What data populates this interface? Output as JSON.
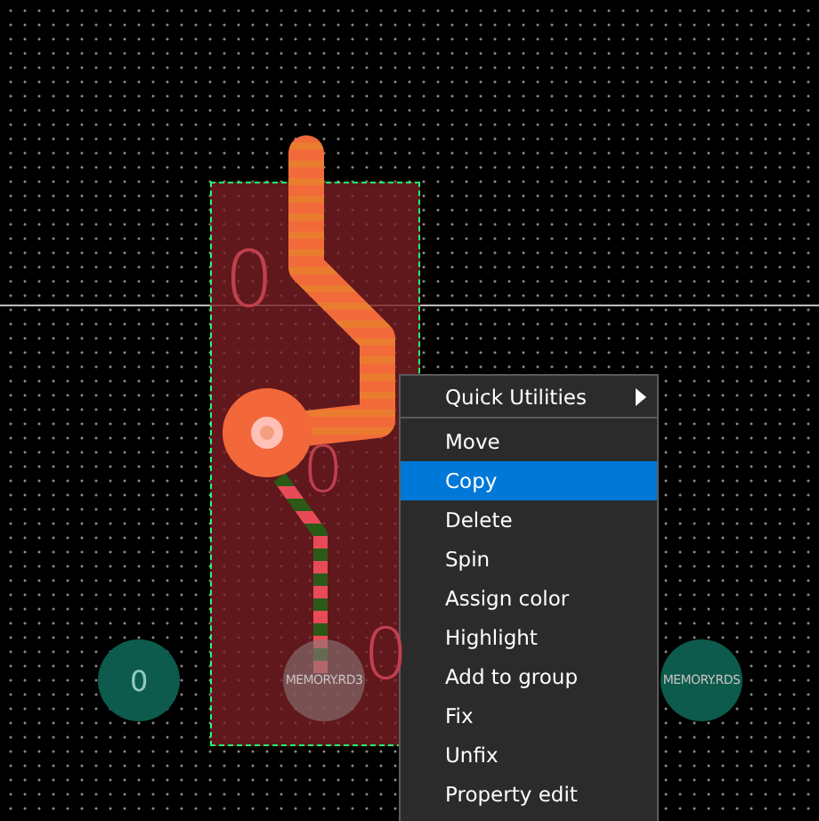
{
  "canvas": {
    "refdes_labels": [
      "0",
      "0",
      "0"
    ],
    "pads": [
      {
        "label": "0",
        "selected": false
      },
      {
        "label": "MEMORY.RD3",
        "selected": true
      },
      {
        "label": "MEMORY.RDS",
        "selected": false
      }
    ]
  },
  "context_menu": {
    "items": [
      {
        "label": "Quick Utilities",
        "kind": "submenu",
        "selected": false
      },
      {
        "label": "Move",
        "kind": "item",
        "selected": false
      },
      {
        "label": "Copy",
        "kind": "item",
        "selected": true
      },
      {
        "label": "Delete",
        "kind": "item",
        "selected": false
      },
      {
        "label": "Spin",
        "kind": "item",
        "selected": false
      },
      {
        "label": "Assign color",
        "kind": "item",
        "selected": false
      },
      {
        "label": "Highlight",
        "kind": "item",
        "selected": false
      },
      {
        "label": "Add to group",
        "kind": "item",
        "selected": false
      },
      {
        "label": "Fix",
        "kind": "item",
        "selected": false
      },
      {
        "label": "Unfix",
        "kind": "item",
        "selected": false
      },
      {
        "label": "Property edit",
        "kind": "item",
        "selected": false
      }
    ]
  }
}
